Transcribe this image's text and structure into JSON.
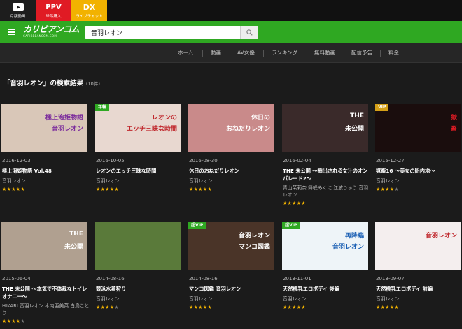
{
  "services": [
    {
      "label": "月額動画"
    },
    {
      "label": "単品購入",
      "icon_text": "PPV"
    },
    {
      "label": "ライブチャット",
      "icon_text": "DX"
    }
  ],
  "header": {
    "logo_main": "カリビアンコム",
    "logo_sub": "CARIBBEANCOM.COM",
    "search_value": "音羽レオン",
    "accent_color": "#2fa822"
  },
  "nav": [
    {
      "label": "ホーム"
    },
    {
      "label": "動画"
    },
    {
      "label": "AV女優"
    },
    {
      "label": "ランキング"
    },
    {
      "label": "無料動画"
    },
    {
      "label": "配信予告"
    },
    {
      "label": "料金"
    }
  ],
  "results": {
    "heading": "「音羽レオン」の検索結果",
    "count": "(10件)"
  },
  "cards": [
    {
      "date": "2016-12-03",
      "title": "極上泡姫物語 Vol.48",
      "actress": "音羽レオン",
      "rating": 5,
      "badge": "",
      "thumb_text": "極上泡姫物語",
      "thumb_text2": "音羽レオン",
      "bg": "#d9c7b8",
      "text_color": "#7a2a9c"
    },
    {
      "date": "2016-10-05",
      "title": "レオンのエッチ三昧な時間",
      "actress": "音羽レオン",
      "rating": 5,
      "badge": "年輪",
      "thumb_text": "レオンの",
      "thumb_text2": "エッチ三昧な時間",
      "bg": "#e8d8d0",
      "text_color": "#c0282d"
    },
    {
      "date": "2016-08-30",
      "title": "休日のおねだりレオン",
      "actress": "音羽レオン",
      "rating": 5,
      "badge": "",
      "thumb_text": "休日の",
      "thumb_text2": "おねだりレオン",
      "bg": "#c98a8a",
      "text_color": "#ffffff"
    },
    {
      "date": "2016-02-04",
      "title": "THE 未公開 ～挿出される女汁のオンパレード2～",
      "actress": "青山茉莉奈 舞咲みくに 江波りゅう 音羽レオン",
      "rating": 5,
      "badge": "",
      "thumb_text": "THE",
      "thumb_text2": "未公開",
      "bg": "#3a2a2a",
      "text_color": "#ffffff"
    },
    {
      "date": "2015-12-27",
      "title": "獄畜16 ～美女の胎内地～",
      "actress": "音羽レオン",
      "rating": 4,
      "badge": "VIP",
      "thumb_text": "獄",
      "thumb_text2": "畜",
      "bg": "#1a0d0d",
      "text_color": "#e01b24"
    },
    {
      "date": "2015-06-04",
      "title": "THE 未公開 ～本気で不体裁なトイレオナニー～",
      "actress": "HIKARI 音羽レオン 木内亜美菜 白鳥ことり",
      "rating": 4,
      "badge": "",
      "thumb_text": "THE",
      "thumb_text2": "未公開",
      "bg": "#b0a090",
      "text_color": "#ffffff"
    },
    {
      "date": "2014-08-16",
      "title": "競泳水着狩り",
      "actress": "音羽レオン",
      "rating": 4,
      "badge": "",
      "thumb_text": "",
      "thumb_text2": "",
      "bg": "#5a7a3a",
      "text_color": "#ffffff"
    },
    {
      "date": "2014-08-16",
      "title": "マンコ図鑑 音羽レオン",
      "actress": "音羽レオン",
      "rating": 5,
      "badge": "超VIP",
      "thumb_text": "音羽レオン",
      "thumb_text2": "マンコ図鑑",
      "bg": "#4a3428",
      "text_color": "#ffffff"
    },
    {
      "date": "2013-11-01",
      "title": "天然桃乳エロボディ 後編",
      "actress": "音羽レオン",
      "rating": 5,
      "badge": "超VIP",
      "thumb_text": "再降臨",
      "thumb_text2": "音羽レオン",
      "bg": "#eef4f8",
      "text_color": "#1a5fb4"
    },
    {
      "date": "2013-09-07",
      "title": "天然桃乳エロボディ 前編",
      "actress": "音羽レオン",
      "rating": 5,
      "badge": "",
      "thumb_text": "音羽レオン",
      "thumb_text2": "",
      "bg": "#f4eeee",
      "text_color": "#c0282d"
    }
  ]
}
